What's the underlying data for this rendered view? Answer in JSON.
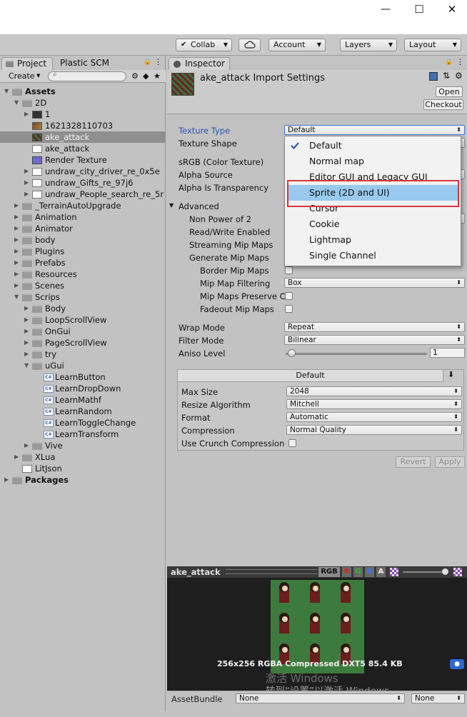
{
  "window": {
    "min": "—",
    "max": "☐",
    "close": "✕"
  },
  "toolbar": {
    "collab": "Collab",
    "account": "Account",
    "layers": "Layers",
    "layout": "Layout"
  },
  "project_panel": {
    "tabs": [
      "Project",
      "Plastic SCM"
    ],
    "create": "Create",
    "tree": [
      {
        "label": "Assets",
        "bold": true
      },
      {
        "label": "2D"
      },
      {
        "label": "1"
      },
      {
        "label": "1621328110703"
      },
      {
        "label": "ake_attack",
        "selected": true
      },
      {
        "label": "ake_attack"
      },
      {
        "label": "Render Texture"
      },
      {
        "label": "undraw_city_driver_re_0x5e"
      },
      {
        "label": "undraw_Gifts_re_97j6"
      },
      {
        "label": "undraw_People_search_re_5r"
      },
      {
        "label": "_TerrainAutoUpgrade"
      },
      {
        "label": "Animation"
      },
      {
        "label": "Animator"
      },
      {
        "label": "body"
      },
      {
        "label": "Plugins"
      },
      {
        "label": "Prefabs"
      },
      {
        "label": "Resources"
      },
      {
        "label": "Scenes"
      },
      {
        "label": "Scrips"
      },
      {
        "label": "Body"
      },
      {
        "label": "LoopScrollView"
      },
      {
        "label": "OnGui"
      },
      {
        "label": "PageScrollView"
      },
      {
        "label": "try"
      },
      {
        "label": "uGui"
      },
      {
        "label": "LearnButton"
      },
      {
        "label": "LearnDropDown"
      },
      {
        "label": "LearnMathf"
      },
      {
        "label": "LearnRandom"
      },
      {
        "label": "LearnToggleChange"
      },
      {
        "label": "LearnTransform"
      },
      {
        "label": "Vive"
      },
      {
        "label": "XLua"
      },
      {
        "label": "LitJson"
      },
      {
        "label": "Packages",
        "bold": true
      }
    ]
  },
  "inspector": {
    "tab": "Inspector",
    "title": "ake_attack Import Settings",
    "open": "Open",
    "checkout": "Checkout",
    "texture_type_label": "Texture Type",
    "texture_type_value": "Default",
    "texture_shape_label": "Texture Shape",
    "srgb_label": "sRGB (Color Texture)",
    "alpha_source_label": "Alpha Source",
    "alpha_transparency_label": "Alpha Is Transparency",
    "advanced_label": "Advanced",
    "non_power_label": "Non Power of 2",
    "read_write_label": "Read/Write Enabled",
    "streaming_label": "Streaming Mip Maps",
    "generate_label": "Generate Mip Maps",
    "border_label": "Border Mip Maps",
    "mip_filter_label": "Mip Map Filtering",
    "mip_filter_value": "Box",
    "preserve_label": "Mip Maps Preserve C",
    "fadeout_label": "Fadeout Mip Maps",
    "wrap_label": "Wrap Mode",
    "wrap_value": "Repeat",
    "filter_label": "Filter Mode",
    "filter_value": "Bilinear",
    "aniso_label": "Aniso Level",
    "aniso_value": "1",
    "platform_tab": "Default",
    "max_size_label": "Max Size",
    "max_size_value": "2048",
    "resize_label": "Resize Algorithm",
    "resize_value": "Mitchell",
    "format_label": "Format",
    "format_value": "Automatic",
    "compression_label": "Compression",
    "compression_value": "Normal Quality",
    "crunch_label": "Use Crunch Compression",
    "revert": "Revert",
    "apply": "Apply"
  },
  "dropdown": {
    "items": [
      "Default",
      "Normal map",
      "Editor GUI and Legacy GUI",
      "Sprite (2D and UI)",
      "Cursor",
      "Cookie",
      "Lightmap",
      "Single Channel"
    ],
    "checked_index": 0,
    "highlighted_index": 3
  },
  "preview": {
    "name": "ake_attack",
    "channels": [
      "RGB",
      "R",
      "G",
      "B",
      "A"
    ],
    "info": "256x256  RGBA Compressed DXT5   85.4 KB",
    "watermark1": "激活 Windows",
    "watermark2": "转到“设置”以激活 Windows。"
  },
  "assetbundle": {
    "label": "AssetBundle",
    "value1": "None",
    "value2": "None"
  },
  "colors": {
    "highlight": "#99c9ef",
    "red_box": "#d9363e",
    "accent": "#2a52be"
  }
}
